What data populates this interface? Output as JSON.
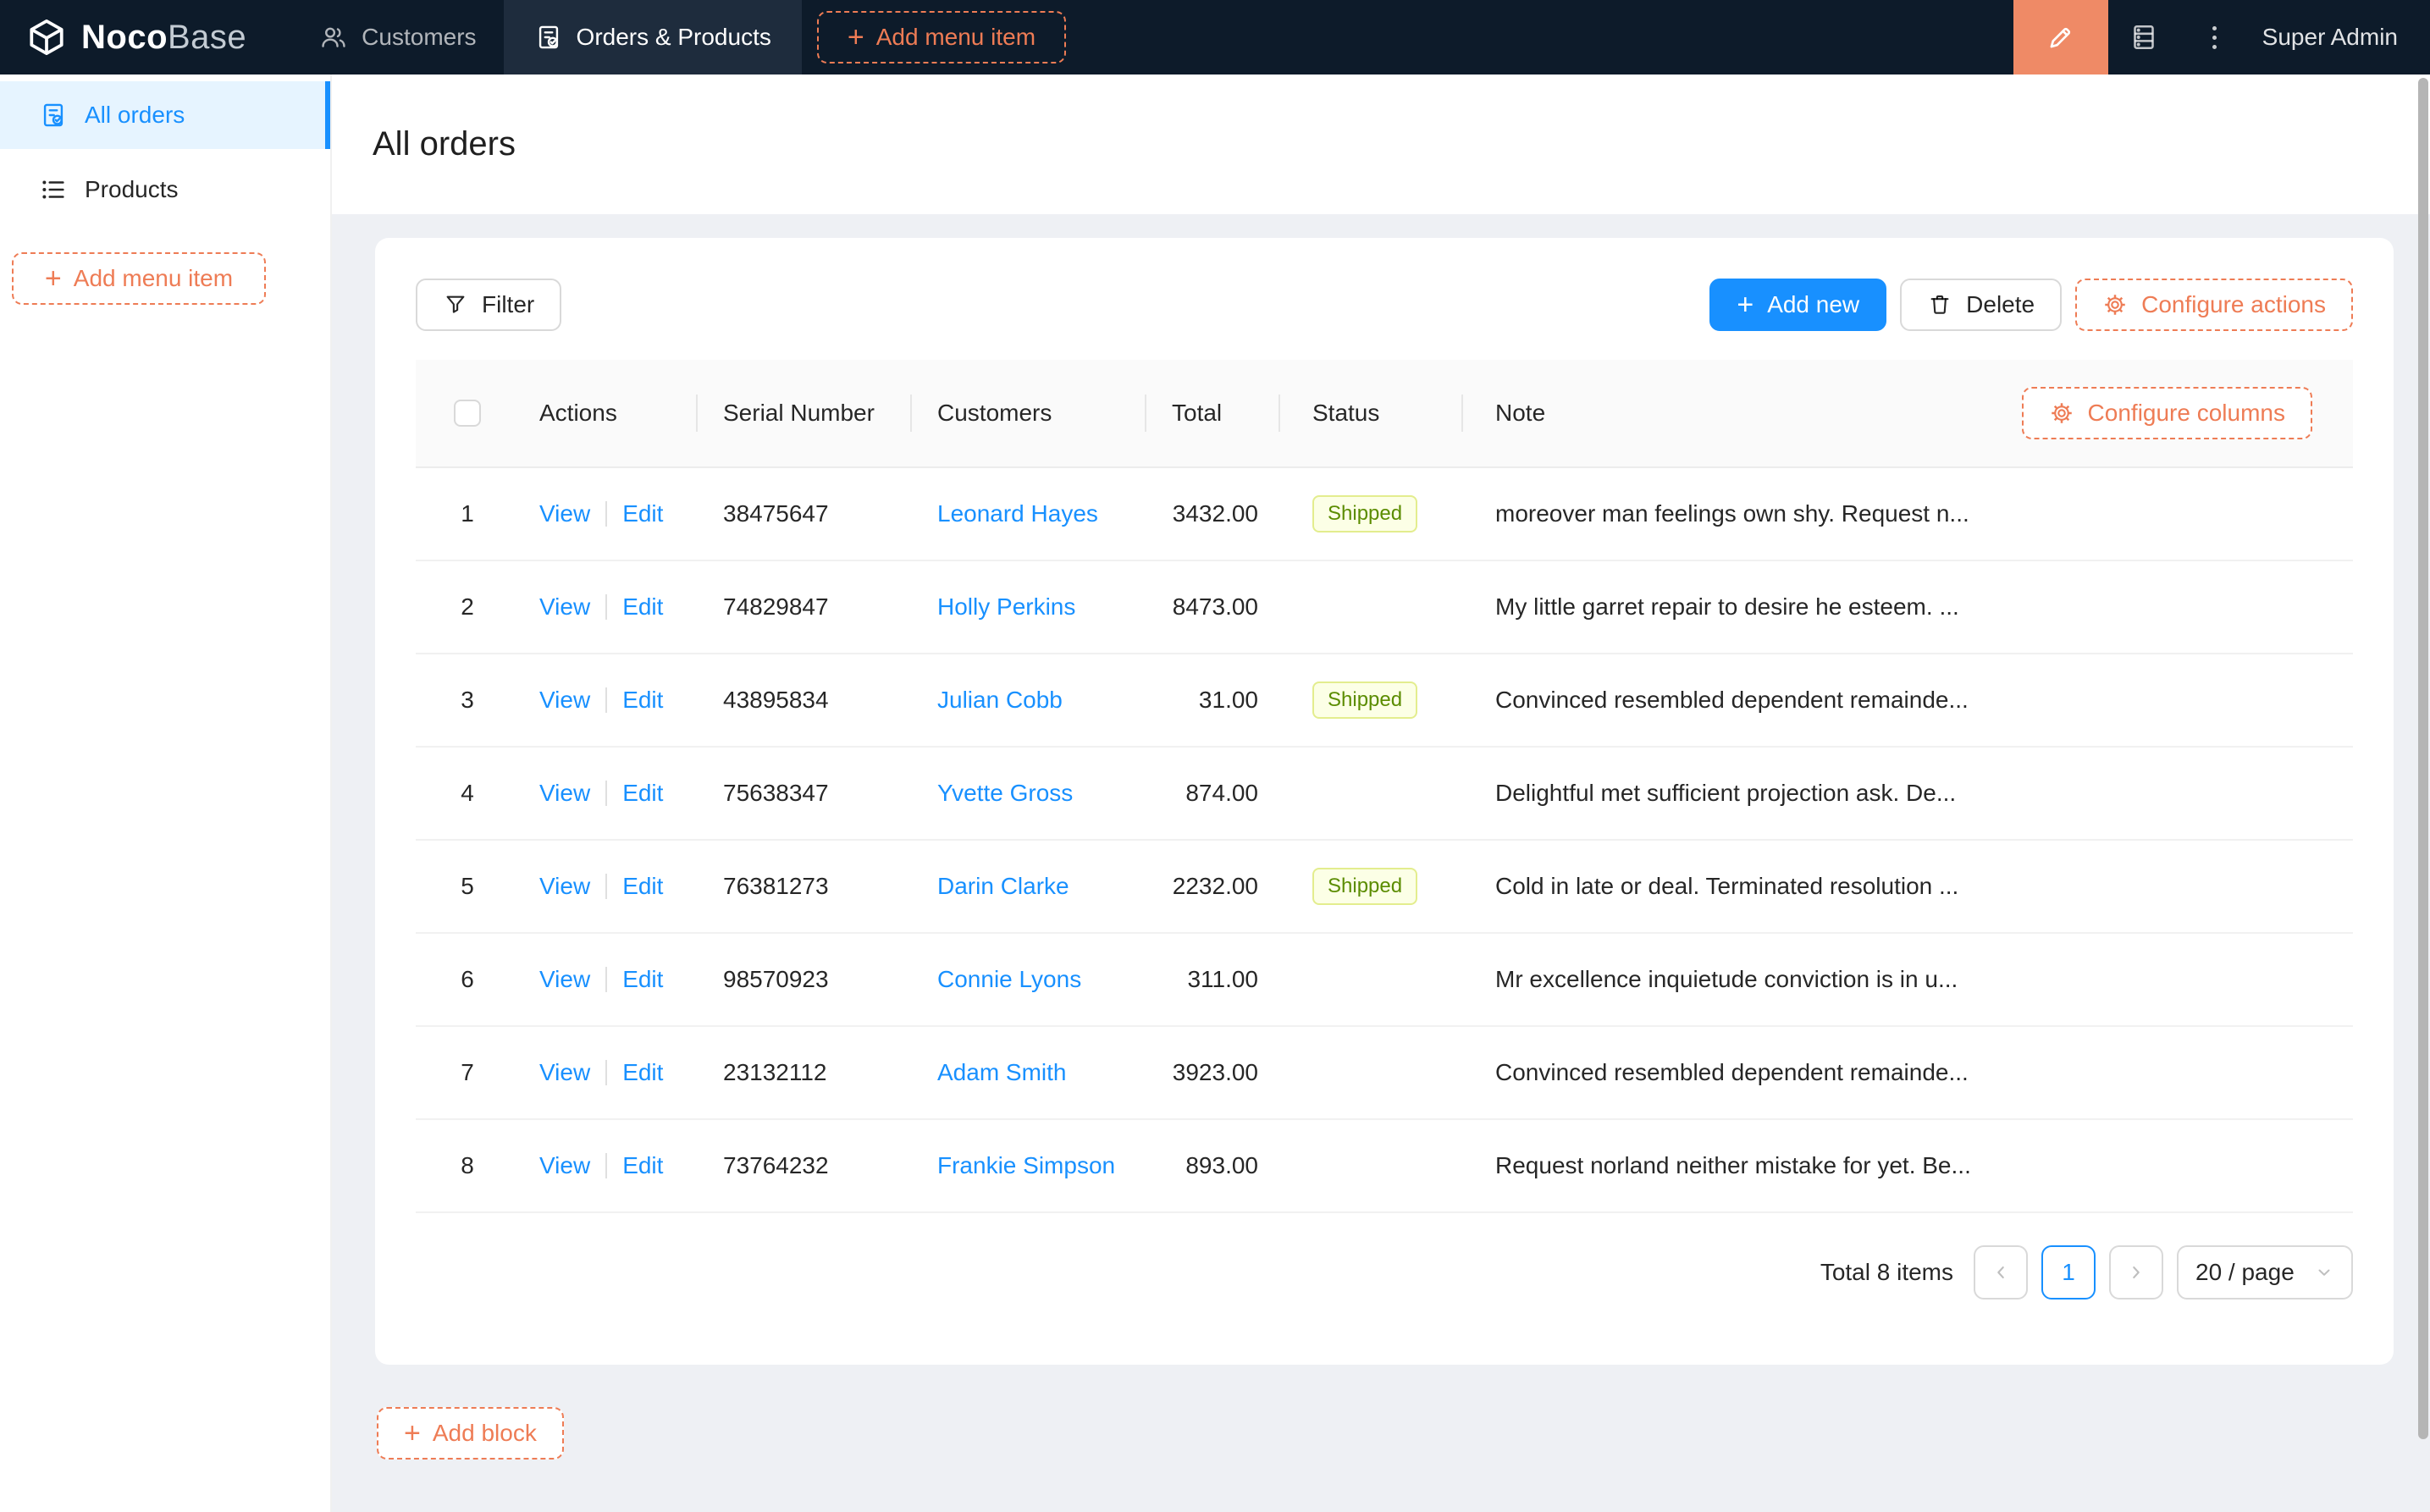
{
  "colors": {
    "navbar_bg": "#0d1b2a",
    "navbar_active_tab_bg": "#1e2c3d",
    "accent_orange": "#ee7c55",
    "orange_square_bg": "#ef8a66",
    "primary_blue": "#1890ff",
    "sidebar_active_bg": "#e6f4ff",
    "page_bg": "#eef0f4",
    "table_header_bg": "#fafafa",
    "tag_bg": "#fcffe6",
    "tag_border": "#e3ed8e",
    "tag_text": "#5b8c00"
  },
  "navbar": {
    "logo_noco": "Noco",
    "logo_base": "Base",
    "menu": [
      {
        "label": "Customers",
        "icon": "team-icon",
        "active": false
      },
      {
        "label": "Orders & Products",
        "icon": "file-check-icon",
        "active": true
      }
    ],
    "add_menu_item": "Add menu item",
    "user": "Super Admin"
  },
  "sidebar": {
    "items": [
      {
        "label": "All orders",
        "icon": "file-check-icon",
        "active": true
      },
      {
        "label": "Products",
        "icon": "list-icon",
        "active": false
      }
    ],
    "add_menu_item": "Add menu item"
  },
  "page_title": "All orders",
  "toolbar": {
    "filter": "Filter",
    "add_new": "Add new",
    "delete": "Delete",
    "configure_actions": "Configure actions"
  },
  "table": {
    "select_all_checked": false,
    "columns": [
      "Actions",
      "Serial Number",
      "Customers",
      "Total",
      "Status",
      "Note"
    ],
    "configure_columns": "Configure columns",
    "actions": {
      "view": "View",
      "edit": "Edit"
    },
    "rows": [
      {
        "index": "1",
        "serial": "38475647",
        "customer": "Leonard Hayes",
        "total": "3432.00",
        "status": "Shipped",
        "note": "moreover man feelings own shy. Request n..."
      },
      {
        "index": "2",
        "serial": "74829847",
        "customer": "Holly Perkins",
        "total": "8473.00",
        "status": "",
        "note": "My little garret repair to desire he esteem. ..."
      },
      {
        "index": "3",
        "serial": "43895834",
        "customer": "Julian Cobb",
        "total": "31.00",
        "status": "Shipped",
        "note": "Convinced resembled dependent remainde..."
      },
      {
        "index": "4",
        "serial": "75638347",
        "customer": "Yvette Gross",
        "total": "874.00",
        "status": "",
        "note": "Delightful met sufficient projection ask. De..."
      },
      {
        "index": "5",
        "serial": "76381273",
        "customer": "Darin Clarke",
        "total": "2232.00",
        "status": "Shipped",
        "note": "Cold in late or deal. Terminated resolution ..."
      },
      {
        "index": "6",
        "serial": "98570923",
        "customer": "Connie Lyons",
        "total": "311.00",
        "status": "",
        "note": "Mr excellence inquietude conviction is in u..."
      },
      {
        "index": "7",
        "serial": "23132112",
        "customer": "Adam Smith",
        "total": "3923.00",
        "status": "",
        "note": "Convinced resembled dependent remainde..."
      },
      {
        "index": "8",
        "serial": "73764232",
        "customer": "Frankie Simpson",
        "total": "893.00",
        "status": "",
        "note": "Request norland neither mistake for yet. Be..."
      }
    ]
  },
  "pagination": {
    "total": "Total 8 items",
    "current_page": "1",
    "page_size": "20 / page"
  },
  "add_block": "Add block"
}
